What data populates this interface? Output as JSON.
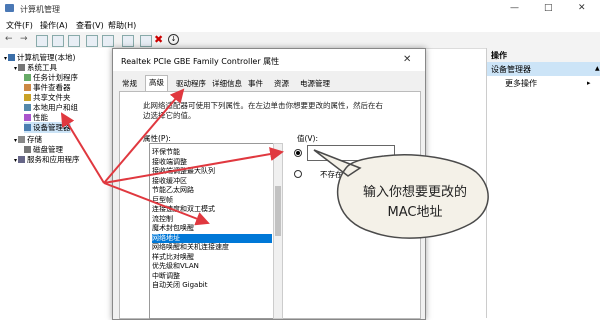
{
  "window": {
    "title": "计算机管理"
  },
  "menu": [
    "文件(F)",
    "操作(A)",
    "查看(V)",
    "帮助(H)"
  ],
  "tree": [
    {
      "label": "计算机管理(本地)",
      "level": 0,
      "icon": "computer-icon"
    },
    {
      "label": "系统工具",
      "level": 1,
      "icon": "tools-icon"
    },
    {
      "label": "任务计划程序",
      "level": 2,
      "icon": "clock-icon"
    },
    {
      "label": "事件查看器",
      "level": 2,
      "icon": "event-icon"
    },
    {
      "label": "共享文件夹",
      "level": 2,
      "icon": "folder-icon"
    },
    {
      "label": "本地用户和组",
      "level": 2,
      "icon": "users-icon"
    },
    {
      "label": "性能",
      "level": 2,
      "icon": "performance-icon"
    },
    {
      "label": "设备管理器",
      "level": 2,
      "icon": "device-manager-icon",
      "selected": true
    },
    {
      "label": "存储",
      "level": 1,
      "icon": "storage-icon"
    },
    {
      "label": "磁盘管理",
      "level": 2,
      "icon": "disk-icon"
    },
    {
      "label": "服务和应用程序",
      "level": 1,
      "icon": "services-icon"
    }
  ],
  "actions": {
    "header": "操作",
    "selected": "设备管理器",
    "more": "更多操作"
  },
  "dialog": {
    "title": "Realtek PCIe GBE Family Controller 属性",
    "tabs": [
      "常规",
      "高级",
      "驱动程序",
      "详细信息",
      "事件",
      "资源",
      "电源管理"
    ],
    "active_tab": 1,
    "description": "此网络适配器可使用下列属性。在左边单击你想要更改的属性，然后在右边选择它的值。",
    "property_label": "属性(P):",
    "properties": [
      "环保节能",
      "接收端调整",
      "接收端调整最大队列",
      "接收缓冲区",
      "节能乙太网路",
      "巨型帧",
      "连接速度和双工模式",
      "流控制",
      "魔术封包唤醒",
      "网络地址",
      "网络唤醒和关机连接速度",
      "样式比对唤醒",
      "优先级和VLAN",
      "中断调整",
      "自动关闭 Gigabit"
    ],
    "selected_property": "网络地址",
    "value_label": "值(V):",
    "value": "",
    "none_label": "不存在(N)"
  },
  "annotation": {
    "text": "输入你想要更改的MAC地址"
  },
  "colors": {
    "arrow": "#e0383f",
    "selection": "#0078d7"
  }
}
